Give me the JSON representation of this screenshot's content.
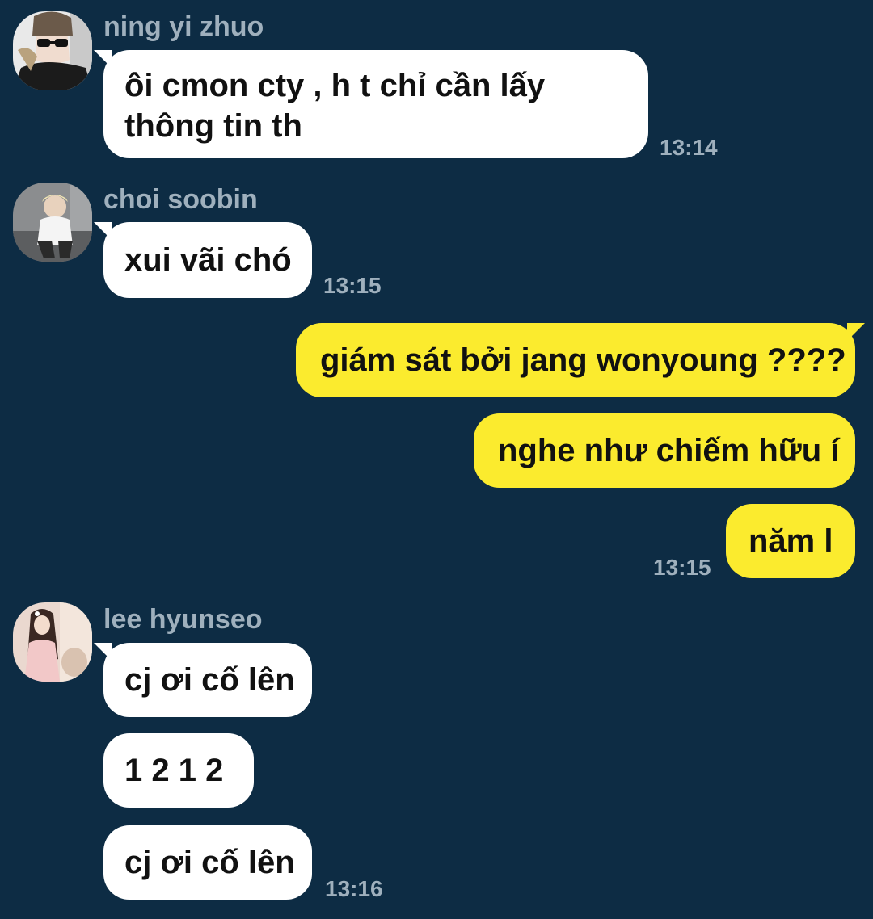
{
  "colors": {
    "background": "#0d2c44",
    "incoming_bubble": "#ffffff",
    "outgoing_bubble": "#fbeb2e",
    "meta_text": "#9fb0bd"
  },
  "messages": {
    "ning": {
      "sender": "ning yi zhuo",
      "text_line1": "ôi cmon cty , h t chỉ cần lấy",
      "text_line2": "thông tin th",
      "time": "13:14"
    },
    "choi": {
      "sender": "choi soobin",
      "text": "xui vãi chó",
      "time": "13:15"
    },
    "me": {
      "msg1": "giám sát bởi jang wonyoung ????",
      "msg2": "nghe như chiếm hữu í",
      "msg3": "năm l",
      "time": "13:15"
    },
    "lee": {
      "sender": "lee hyunseo",
      "msg1": "cj ơi cố lên",
      "msg2": "1 2 1 2",
      "msg3": "cj ơi cố lên",
      "time": "13:16"
    }
  }
}
